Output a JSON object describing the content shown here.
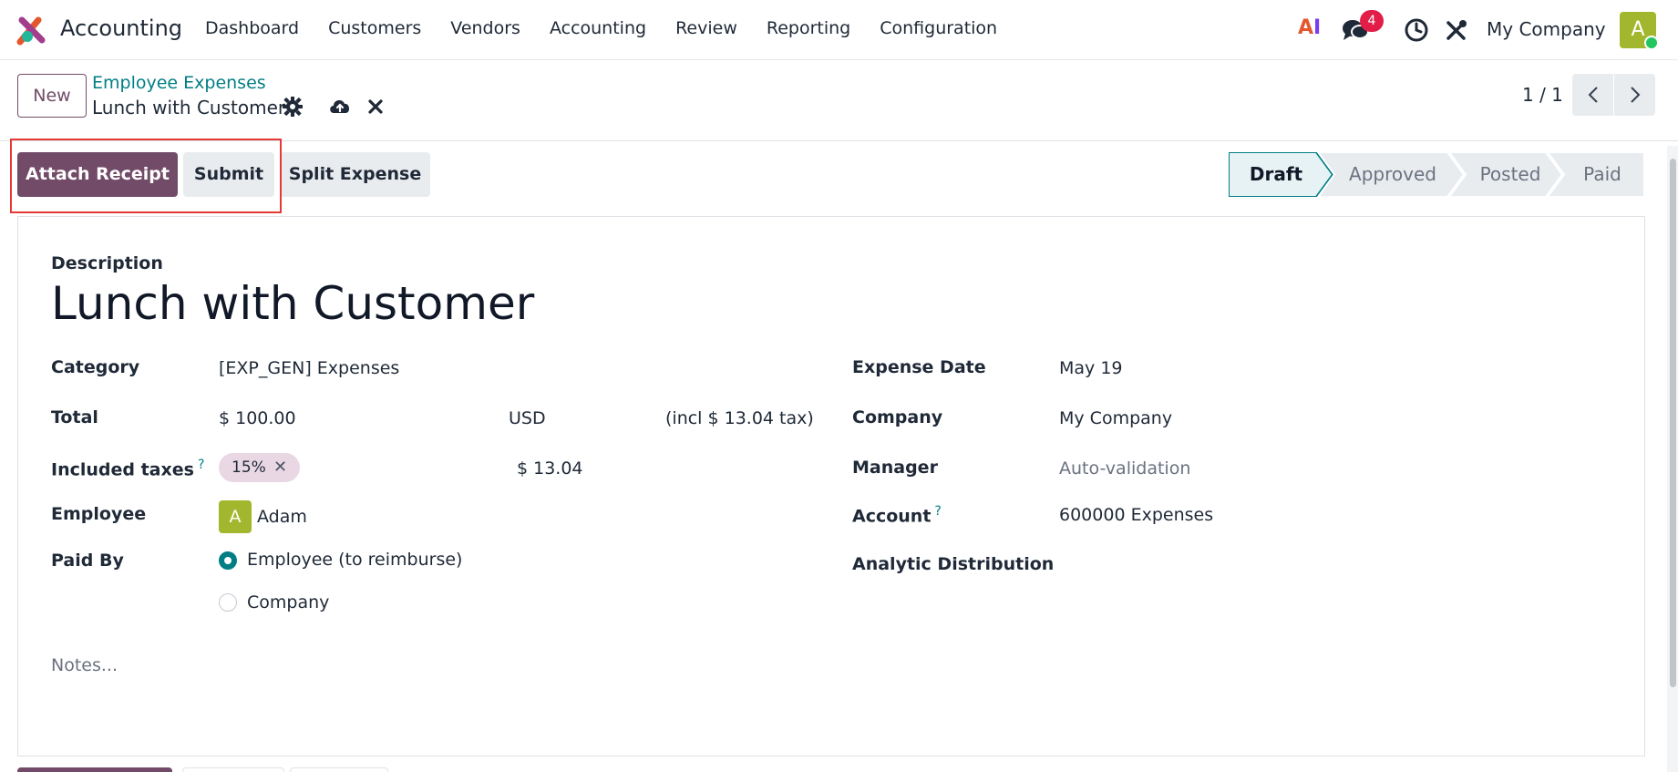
{
  "navbar": {
    "app_name": "Accounting",
    "menu": [
      "Dashboard",
      "Customers",
      "Vendors",
      "Accounting",
      "Review",
      "Reporting",
      "Configuration"
    ],
    "ai_label_a": "A",
    "ai_label_i": "I",
    "message_count": "4",
    "company": "My Company",
    "user_initial": "A"
  },
  "control_panel": {
    "new_label": "New",
    "breadcrumb_parent": "Employee Expenses",
    "breadcrumb_current": "Lunch with Customer",
    "pager": "1 / 1"
  },
  "actions": {
    "attach_receipt": "Attach Receipt",
    "submit": "Submit",
    "split_expense": "Split Expense"
  },
  "status": {
    "stages": [
      "Draft",
      "Approved",
      "Posted",
      "Paid"
    ],
    "current": "Draft"
  },
  "form": {
    "description_label": "Description",
    "title": "Lunch with Customer",
    "category_label": "Category",
    "category_value": "[EXP_GEN] Expenses",
    "total_label": "Total",
    "total_value": "$ 100.00",
    "currency": "USD",
    "tax_note": "(incl $ 13.04 tax)",
    "included_taxes_label": "Included taxes",
    "help_mark": "?",
    "tax_tag": "15%",
    "tax_tag_remove": "✕",
    "tax_amount": "$ 13.04",
    "employee_label": "Employee",
    "employee_initial": "A",
    "employee_value": "Adam",
    "paid_by_label": "Paid By",
    "paid_by_options": [
      "Employee (to reimburse)",
      "Company"
    ],
    "paid_by_selected": "Employee (to reimburse)",
    "expense_date_label": "Expense Date",
    "expense_date_value": "May 19",
    "company_label": "Company",
    "company_value": "My Company",
    "manager_label": "Manager",
    "manager_value": "Auto-validation",
    "account_label": "Account",
    "account_value": "600000 Expenses",
    "analytic_label": "Analytic Distribution",
    "notes_placeholder": "Notes..."
  },
  "colors": {
    "primary": "#714b67",
    "accent": "#017e84",
    "badge": "#e11d48",
    "avatar": "#a3b72e"
  }
}
